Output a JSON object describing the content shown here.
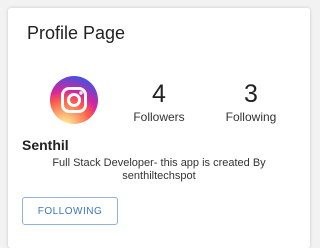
{
  "page": {
    "title": "Profile Page"
  },
  "profile": {
    "avatar_icon": "instagram-icon",
    "name": "Senthil",
    "bio_line1": "Full Stack Developer- this app is created By",
    "bio_line2": "senthiltechspot"
  },
  "stats": {
    "followers_count": "4",
    "followers_label": "Followers",
    "following_count": "3",
    "following_label": "Following"
  },
  "actions": {
    "following_button": "FOLLOWING"
  },
  "colors": {
    "accent": "#3a78c2",
    "button_border": "#8fb3d9"
  }
}
